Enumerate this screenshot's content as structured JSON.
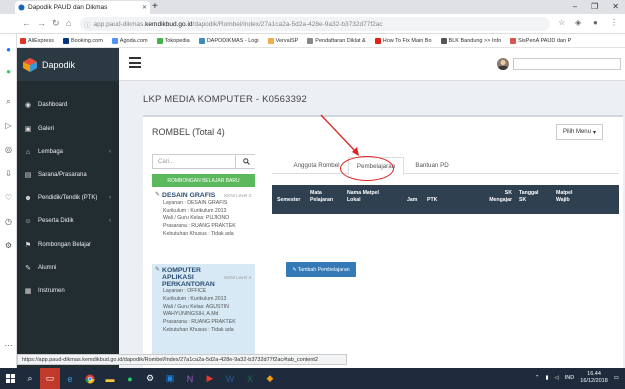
{
  "browser": {
    "tab_title": "Dapodik PAUD dan Dikmas",
    "new_tab": "+",
    "window_controls": [
      "–",
      "❐",
      "✕"
    ],
    "url_prefix": "app.paud-dikmas.",
    "url_domain": "kemdikbud.go.id",
    "url_path": "/dapodik/Rombel/Index/27a1ca2a-5d2a-428e-9a32-b3732d77f2ac",
    "bookmarks": [
      {
        "label": "AliExpress",
        "color": "#e43225"
      },
      {
        "label": "Booking.com",
        "color": "#003580"
      },
      {
        "label": "Agoda.com",
        "color": "#5392f9"
      },
      {
        "label": "Tokopedia",
        "color": "#42b549"
      },
      {
        "label": "DAPODIKMAS - Logi",
        "color": "#3c8dbc"
      },
      {
        "label": "VervalSP",
        "color": "#f0ad4e"
      },
      {
        "label": "Pendaftaran Diklat &",
        "color": "#888888"
      },
      {
        "label": "How To Fix Main Bo",
        "color": "#e62117"
      },
      {
        "label": "BLK Bandung >> Info",
        "color": "#555555"
      },
      {
        "label": "SisPenA PAUD dan P",
        "color": "#d9534f"
      }
    ],
    "status_url": "https://app.paud-dikmas.kemdikbud.go.id/dapodik/Rombel/Index/27a1ca2a-5d2a-428e-9a32-b3732d77f2ac#tab_content2"
  },
  "app": {
    "brand": "Dapodik",
    "nav": [
      {
        "label": "Dashboard",
        "icon": "dashboard-icon",
        "glyph": "◉"
      },
      {
        "label": "Galeri",
        "icon": "camera-icon",
        "glyph": "▣"
      },
      {
        "label": "Lembaga",
        "icon": "home-icon",
        "glyph": "⌂",
        "has_children": true
      },
      {
        "label": "Sarana/Prasarana",
        "icon": "building-icon",
        "glyph": "▤"
      },
      {
        "label": "Pendidik/Tendik (PTK)",
        "icon": "users-icon",
        "glyph": "☻",
        "has_children": true
      },
      {
        "label": "Peserta Didik",
        "icon": "student-icon",
        "glyph": "☺",
        "has_children": true
      },
      {
        "label": "Rombongan Belajar",
        "icon": "group-icon",
        "glyph": "⚑"
      },
      {
        "label": "Alumni",
        "icon": "graduation-icon",
        "glyph": "✎"
      },
      {
        "label": "Instrumen",
        "icon": "clipboard-icon",
        "glyph": "▦"
      }
    ]
  },
  "page": {
    "title": "LKP MEDIA KOMPUTER - K0563392",
    "box_title": "ROMBEL (Total 4)",
    "menu_button": "Pilih Menu",
    "search_placeholder": "Cari...",
    "add_button": "ROMBONGAN BELAJAR BARU",
    "rombels": [
      {
        "name": "DESAIN GRAFIS",
        "level": "KKNI Level 3",
        "lines": [
          "Layanan : DESAIN GRAFIS",
          "Kurikulum : Kurikulum 2013",
          "Wali / Guru Kelas: PUJIONO",
          "Prasarana : RUANG PRAKTEK",
          "Kebutuhan Khusus : Tidak ada"
        ]
      },
      {
        "name": "KOMPUTER APLIKASI PERKANTORAN",
        "level": "KKNI Level 3",
        "lines": [
          "Layanan : OFFICE",
          "Kurikulum : Kurikulum 2013",
          "Wali / Guru Kelas: AGUSTIN WAHYUNINGSIH, A.Md",
          "Prasarana : RUANG PRAKTEK",
          "Kebutuhan Khusus : Tidak ada"
        ]
      }
    ],
    "tabs": [
      "Anggota Rombel",
      "Pembelajaran",
      "Bantuan PD"
    ],
    "active_tab": "Pembelajaran",
    "table_headers": [
      "Semester",
      "Mata Pelajaran",
      "Nama Matpel Lokal",
      "Jam",
      "PTK",
      "SK Mengajar",
      "Tanggal SK",
      "Matpel Wajib"
    ],
    "add_lesson_button": "Tambah Pembelajaran"
  },
  "taskbar": {
    "items": [
      "start-icon",
      "search-icon",
      "task-view-icon",
      "edge-icon",
      "chrome-icon",
      "explorer-icon",
      "whatsapp-icon",
      "settings-icon",
      "photos-icon",
      "onenote-icon",
      "video-icon",
      "word-icon",
      "excel-icon",
      "paint-icon"
    ],
    "language": "IND",
    "time": "16.44",
    "date": "16/12/2018"
  },
  "colors": {
    "sidebar": "#222d32",
    "table_header": "#2f4050",
    "green_button": "#5cb85c",
    "blue_button": "#337ab7",
    "annotation_red": "#e0211d",
    "selected_rombel": "#d6e9f5"
  }
}
